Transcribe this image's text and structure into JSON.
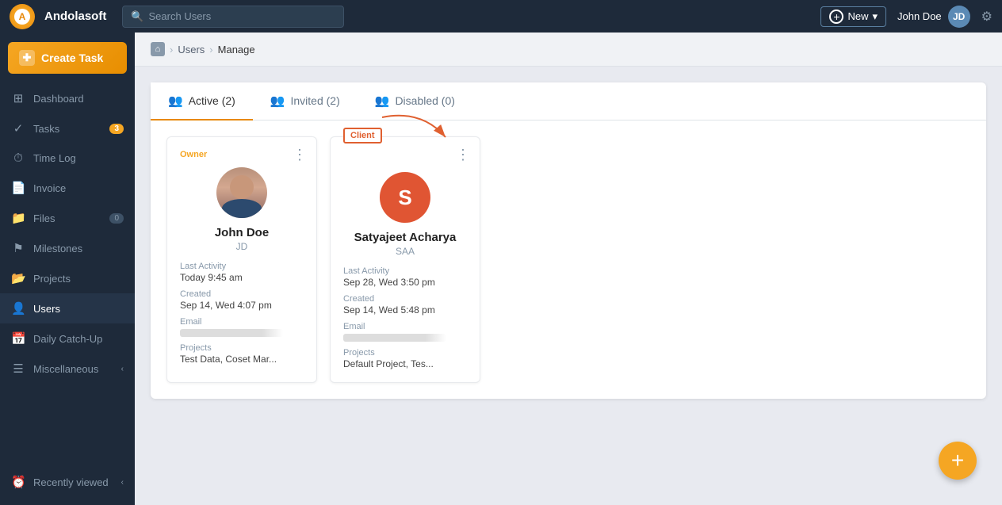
{
  "brand": {
    "name": "Andolasoft",
    "logo_alt": "Andolasoft logo"
  },
  "topnav": {
    "search_placeholder": "Search Users",
    "new_button_label": "New",
    "user_name": "John Doe",
    "chevron": "▾"
  },
  "sidebar": {
    "create_task_label": "Create Task",
    "items": [
      {
        "id": "dashboard",
        "label": "Dashboard",
        "icon": "⊞",
        "badge": null
      },
      {
        "id": "tasks",
        "label": "Tasks",
        "icon": "✓",
        "badge": "3"
      },
      {
        "id": "timelog",
        "label": "Time Log",
        "icon": "⏱",
        "badge": null
      },
      {
        "id": "invoice",
        "label": "Invoice",
        "icon": "📄",
        "badge": null
      },
      {
        "id": "files",
        "label": "Files",
        "icon": "📁",
        "badge": "0"
      },
      {
        "id": "milestones",
        "label": "Milestones",
        "icon": "⚑",
        "badge": null
      },
      {
        "id": "projects",
        "label": "Projects",
        "icon": "📂",
        "badge": null
      },
      {
        "id": "users",
        "label": "Users",
        "icon": "👤",
        "badge": null,
        "active": true
      },
      {
        "id": "daily-catchup",
        "label": "Daily Catch-Up",
        "icon": "📅",
        "badge": null
      },
      {
        "id": "miscellaneous",
        "label": "Miscellaneous",
        "icon": "☰",
        "badge": null,
        "has_arrow": true
      }
    ],
    "recently_viewed_label": "Recently viewed"
  },
  "breadcrumb": {
    "home_icon": "⌂",
    "separator": ">",
    "users_link": "Users",
    "current": "Manage"
  },
  "users_page": {
    "tabs": [
      {
        "id": "active",
        "label": "Active (2)",
        "icon": "👥",
        "active": true
      },
      {
        "id": "invited",
        "label": "Invited (2)",
        "icon": "👥",
        "active": false
      },
      {
        "id": "disabled",
        "label": "Disabled (0)",
        "icon": "👥",
        "active": false
      }
    ],
    "users": [
      {
        "id": "john-doe",
        "role_label": "Owner",
        "name": "John Doe",
        "initials": "JD",
        "avatar_type": "image",
        "last_activity_label": "Last Activity",
        "last_activity": "Today 9:45 am",
        "created_label": "Created",
        "created": "Sep 14, Wed 4:07 pm",
        "email_label": "Email",
        "email_masked": "••••••••••••••••",
        "projects_label": "Projects",
        "projects": "Test Data, Coset Mar..."
      },
      {
        "id": "satyajeet-acharya",
        "role_label": "Client",
        "name": "Satyajeet Acharya",
        "initials": "SAA",
        "avatar_type": "letter",
        "avatar_letter": "S",
        "last_activity_label": "Last Activity",
        "last_activity": "Sep 28, Wed 3:50 pm",
        "created_label": "Created",
        "created": "Sep 14, Wed 5:48 pm",
        "email_label": "Email",
        "email_masked": "••••••••••••••••",
        "projects_label": "Projects",
        "projects": "Default Project, Tes..."
      }
    ],
    "annotation": {
      "client_tag": "Client",
      "arrow_visible": true
    }
  },
  "fab": {
    "icon": "+"
  }
}
